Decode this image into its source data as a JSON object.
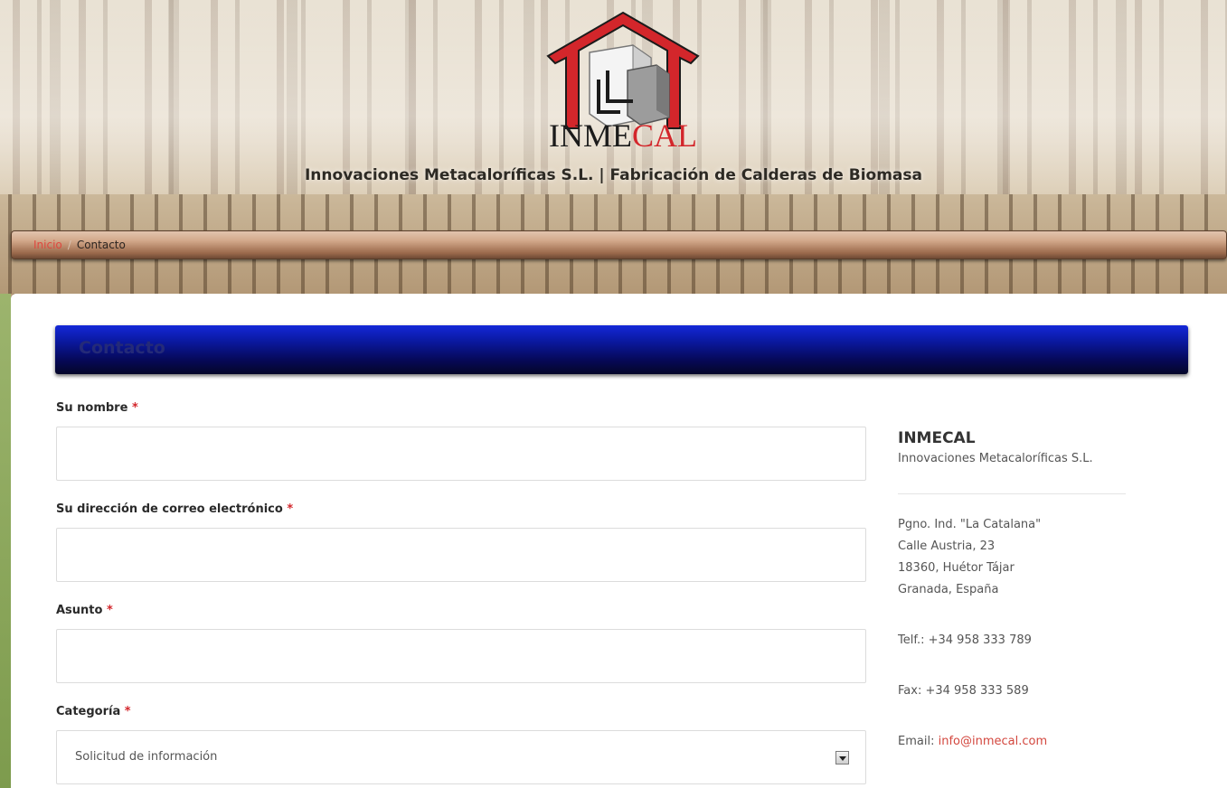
{
  "header": {
    "logo_text_black": "INME",
    "logo_text_red": "CAL",
    "tagline": "Innovaciones Metacaloríficas S.L. | Fabricación de Calderas de Biomasa"
  },
  "breadcrumb": {
    "home": "Inicio",
    "separator": "/",
    "current": "Contacto"
  },
  "page": {
    "title": "Contacto"
  },
  "form": {
    "required_mark": "*",
    "name_label": "Su nombre",
    "name_value": "",
    "email_label": "Su dirección de correo electrónico",
    "email_value": "",
    "subject_label": "Asunto",
    "subject_value": "",
    "category_label": "Categoría",
    "category_selected": "Solicitud de información"
  },
  "contact": {
    "company": "INMECAL",
    "company_full": "Innovaciones Metacaloríficas S.L.",
    "address": [
      "Pgno. Ind. \"La Catalana\"",
      "Calle Austria, 23",
      "18360, Huétor Tájar",
      "Granada, España"
    ],
    "phone": "Telf.: +34 958 333 789",
    "fax": "Fax: +34 958 333 589",
    "email_label": "Email:",
    "email": "info@inmecal.com"
  },
  "colors": {
    "accent_red": "#d3262b",
    "header_blue": "#0b1aa5",
    "breadcrumb_brown": "#9b6a4c"
  }
}
